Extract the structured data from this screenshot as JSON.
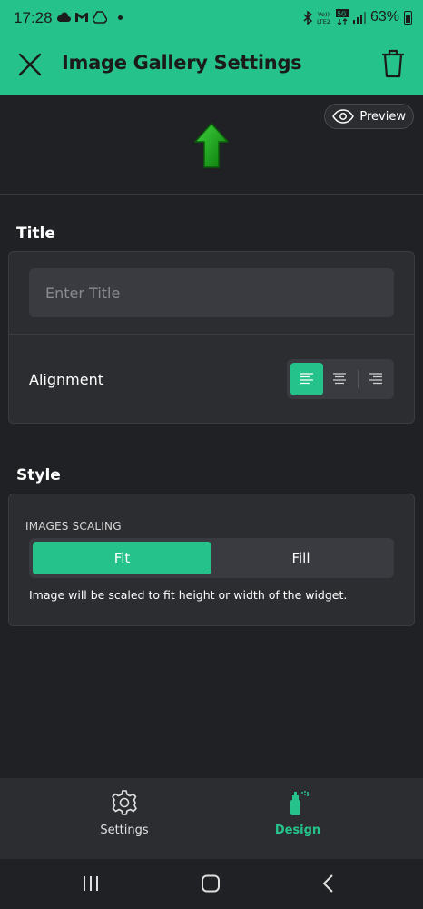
{
  "status_bar": {
    "time": "17:28",
    "battery": "63%",
    "network_label": "5G",
    "volte_label": "Vo))\nLTE2"
  },
  "header": {
    "title": "Image Gallery Settings",
    "close_icon": "close-icon",
    "delete_icon": "trash-icon"
  },
  "preview": {
    "button_label": "Preview",
    "icon": "eye-icon",
    "widget_icon": "green-up-arrow"
  },
  "title_section": {
    "heading": "Title",
    "input_placeholder": "Enter Title",
    "input_value": "",
    "alignment_label": "Alignment",
    "alignment_options": [
      "left",
      "center",
      "right"
    ],
    "alignment_selected": "left"
  },
  "style_section": {
    "heading": "Style",
    "scaling_caption": "IMAGES SCALING",
    "options": [
      "Fit",
      "Fill"
    ],
    "selected": "Fit",
    "help_text": "Image will be scaled to fit height or width of the widget."
  },
  "bottom_nav": {
    "items": [
      {
        "label": "Settings",
        "icon": "gear-icon",
        "active": false
      },
      {
        "label": "Design",
        "icon": "spray-can-icon",
        "active": true
      }
    ]
  },
  "colors": {
    "accent": "#25c38b",
    "background": "#202124",
    "card": "#2c2d31"
  }
}
